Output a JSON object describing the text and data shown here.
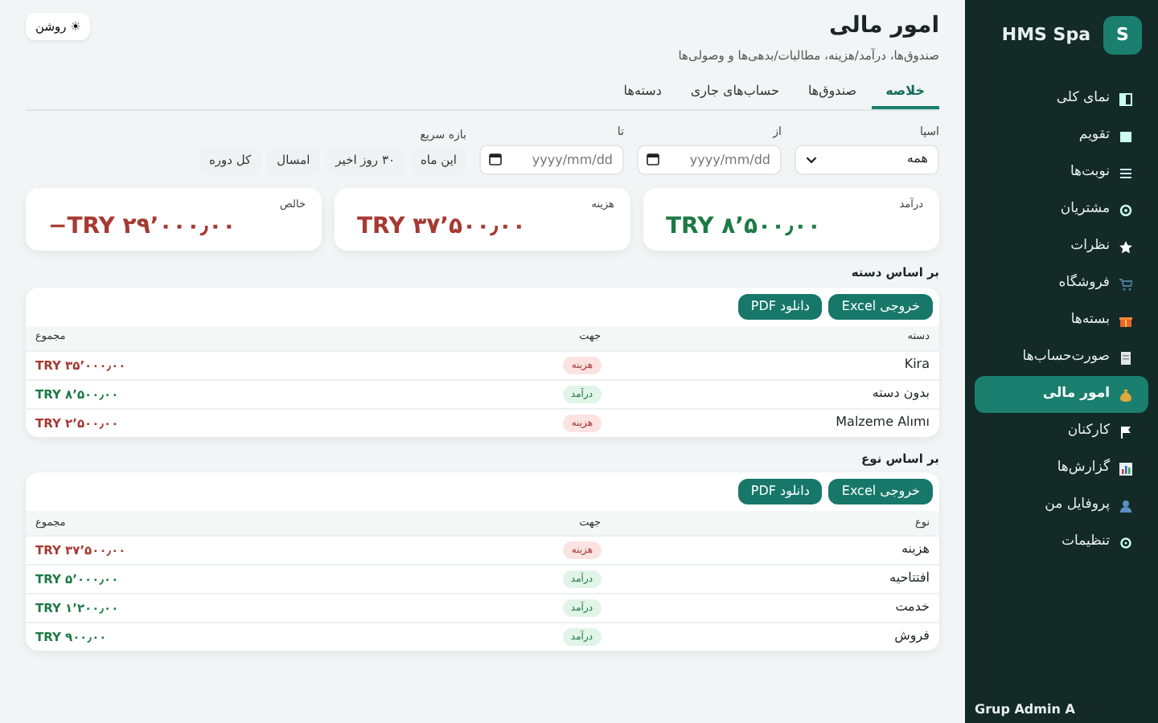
{
  "sidebar": {
    "logo_letter": "S",
    "brand": "HMS Spa",
    "items": [
      {
        "label": "نمای کلی",
        "selected": false
      },
      {
        "label": "تقویم",
        "selected": false
      },
      {
        "label": "نوبت‌ها",
        "selected": false
      },
      {
        "label": "مشتریان",
        "selected": false
      },
      {
        "label": "نظرات",
        "selected": false
      },
      {
        "label": "فروشگاه",
        "selected": false
      },
      {
        "label": "بسته‌ها",
        "selected": false
      },
      {
        "label": "صورت‌حساب‌ها",
        "selected": false
      },
      {
        "label": "امور مالی",
        "selected": true
      },
      {
        "label": "کارکنان",
        "selected": false
      },
      {
        "label": "گزارش‌ها",
        "selected": false
      },
      {
        "label": "پروفایل من",
        "selected": false
      },
      {
        "label": "تنظیمات",
        "selected": false
      }
    ],
    "user": "Grup Admin A"
  },
  "header": {
    "title": "امور مالی",
    "subtitle": "صندوق‌ها، درآمد/هزینه، مطالبات/بدهی‌ها و وصولی‌ها",
    "theme_toggle": {
      "icon": "☀",
      "label": "روشن"
    }
  },
  "tabs": [
    {
      "label": "خلاصه",
      "selected": true
    },
    {
      "label": "صندوق‌ها",
      "selected": false
    },
    {
      "label": "حساب‌های جاری",
      "selected": false
    },
    {
      "label": "دسته‌ها",
      "selected": false
    }
  ],
  "filters": {
    "spa": {
      "label": "اسپا",
      "value": "همه"
    },
    "from": {
      "label": "از",
      "placeholder": "yyyy/mm/dd"
    },
    "to": {
      "label": "تا",
      "placeholder": "yyyy/mm/dd"
    },
    "quick": {
      "label": "بازه سریع",
      "options": [
        "این ماه",
        "۳۰ روز اخیر",
        "امسال",
        "کل دوره"
      ]
    }
  },
  "summary_cards": [
    {
      "label": "درآمد",
      "value": "TRY ۸٬۵۰۰٫۰۰",
      "kind": "income"
    },
    {
      "label": "هزینه",
      "value": "TRY ۳۷٬۵۰۰٫۰۰",
      "kind": "expense"
    },
    {
      "label": "خالص",
      "value": "−TRY ۲۹٬۰۰۰٫۰۰",
      "kind": "expense"
    }
  ],
  "sections": [
    {
      "title": "بر اساس دسته",
      "buttons": [
        "خروجی Excel",
        "دانلود PDF"
      ],
      "columns": [
        "دسته",
        "جهت",
        "مجموع"
      ],
      "rows": [
        {
          "name": "Kira",
          "direction": "هزینه",
          "kind": "expense",
          "total": "TRY ۳۵٬۰۰۰٫۰۰"
        },
        {
          "name": "بدون دسته",
          "direction": "درآمد",
          "kind": "income",
          "total": "TRY ۸٬۵۰۰٫۰۰"
        },
        {
          "name": "Malzeme Alımı",
          "direction": "هزینه",
          "kind": "expense",
          "total": "TRY ۲٬۵۰۰٫۰۰"
        }
      ]
    },
    {
      "title": "بر اساس نوع",
      "buttons": [
        "خروجی Excel",
        "دانلود PDF"
      ],
      "columns": [
        "نوع",
        "جهت",
        "مجموع"
      ],
      "rows": [
        {
          "name": "هزینه",
          "direction": "هزینه",
          "kind": "expense",
          "total": "TRY ۳۷٬۵۰۰٫۰۰"
        },
        {
          "name": "افتتاحیه",
          "direction": "درآمد",
          "kind": "income",
          "total": "TRY ۵٬۰۰۰٫۰۰"
        },
        {
          "name": "خدمت",
          "direction": "درآمد",
          "kind": "income",
          "total": "TRY ۱٬۲۰۰٫۰۰"
        },
        {
          "name": "فروش",
          "direction": "درآمد",
          "kind": "income",
          "total": "TRY ۹۰۰٫۰۰"
        }
      ]
    }
  ]
}
